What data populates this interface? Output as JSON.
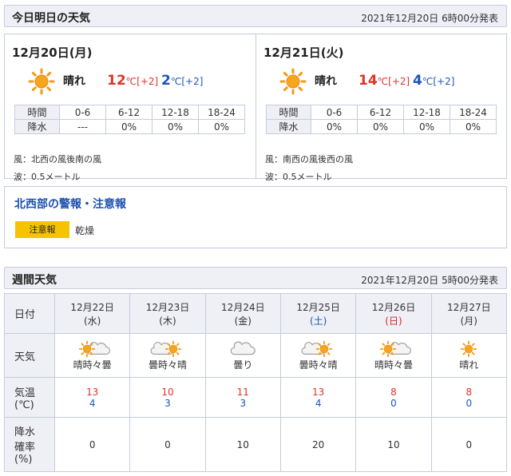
{
  "today": {
    "title": "今日明日の天気",
    "issued": "2021年12月20日 6時00分発表",
    "days": [
      {
        "date": "12月20日(月)",
        "icon": "sun-icon",
        "weather": "晴れ",
        "high": "12",
        "high_unit": "℃",
        "high_diff": "[+2]",
        "low": "2",
        "low_unit": "℃",
        "low_diff": "[+2]",
        "rain_header": [
          "時間",
          "0-6",
          "6-12",
          "12-18",
          "18-24"
        ],
        "rain_row": [
          "降水",
          "---",
          "0%",
          "0%",
          "0%"
        ],
        "wind": "風：北西の風後南の風",
        "wave": "波：0.5メートル"
      },
      {
        "date": "12月21日(火)",
        "icon": "sun-icon",
        "weather": "晴れ",
        "high": "14",
        "high_unit": "℃",
        "high_diff": "[+2]",
        "low": "4",
        "low_unit": "℃",
        "low_diff": "[+2]",
        "rain_header": [
          "時間",
          "0-6",
          "6-12",
          "12-18",
          "18-24"
        ],
        "rain_row": [
          "降水",
          "0%",
          "0%",
          "0%",
          "0%"
        ],
        "wind": "風：南西の風後西の風",
        "wave": "波：0.5メートル"
      }
    ]
  },
  "warnings": {
    "title": "北西部の警報・注意報",
    "badge": "注意報",
    "item": "乾燥",
    "badge_color": "#f5c400"
  },
  "weekly": {
    "title": "週間天気",
    "issued": "2021年12月20日 5時00分発表",
    "labels": {
      "date": "日付",
      "weather": "天気",
      "temp_line1": "気温",
      "temp_line2": "(℃)",
      "rain_line1": "降水",
      "rain_line2": "確率",
      "rain_line3": "(%)"
    },
    "days": [
      {
        "date": "12月22日",
        "dow": "(水)",
        "icon": "sun-cloud-icon",
        "weather": "晴時々曇",
        "high": "13",
        "low": "4",
        "rain": "0"
      },
      {
        "date": "12月23日",
        "dow": "(木)",
        "icon": "cloud-sun-icon",
        "weather": "曇時々晴",
        "high": "10",
        "low": "3",
        "rain": "0"
      },
      {
        "date": "12月24日",
        "dow": "(金)",
        "icon": "cloud-icon",
        "weather": "曇り",
        "high": "11",
        "low": "3",
        "rain": "10"
      },
      {
        "date": "12月25日",
        "dow": "(土)",
        "icon": "cloud-sun-icon",
        "weather": "曇時々晴",
        "high": "13",
        "low": "4",
        "rain": "20"
      },
      {
        "date": "12月26日",
        "dow": "(日)",
        "icon": "sun-cloud-icon",
        "weather": "晴時々曇",
        "high": "8",
        "low": "0",
        "rain": "10"
      },
      {
        "date": "12月27日",
        "dow": "(月)",
        "icon": "sun-icon",
        "weather": "晴れ",
        "high": "8",
        "low": "0",
        "rain": "0"
      }
    ]
  },
  "colors": {
    "high": "#e0342a",
    "low": "#1c56b8",
    "saturday": "#1c56b8",
    "sunday": "#d3262d",
    "sun": "#f39c12"
  }
}
